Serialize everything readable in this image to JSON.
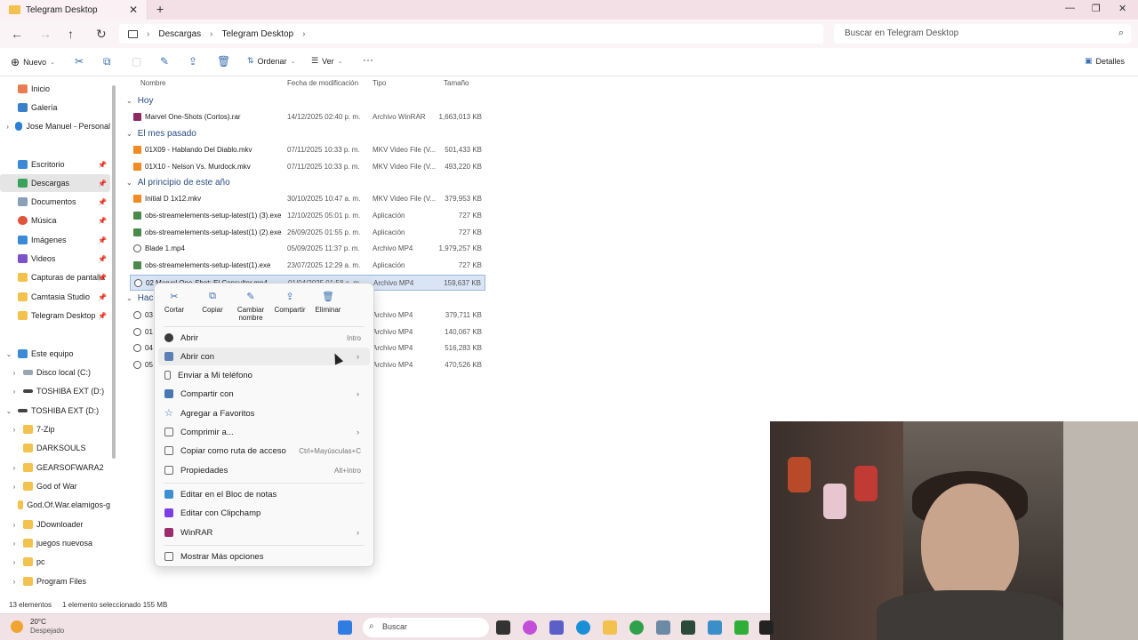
{
  "window": {
    "tab_title": "Telegram Desktop",
    "close_glyph": "✕",
    "new_tab_glyph": "+",
    "minimize_glyph": "—",
    "maximize_glyph": "❐",
    "close_window_glyph": "✕"
  },
  "nav": {
    "back": "←",
    "forward": "→",
    "up": "↑",
    "refresh": "↻",
    "breadcrumbs": [
      "Descargas",
      "Telegram Desktop"
    ],
    "separator": "›",
    "search_placeholder": "Buscar en Telegram Desktop"
  },
  "toolbar": {
    "new_label": "Nuevo",
    "sort_label": "Ordenar",
    "view_label": "Ver",
    "more_label": "···",
    "details_label": "Detalles"
  },
  "sidebar": {
    "items": [
      {
        "label": "Inicio",
        "icon": "home-icon"
      },
      {
        "label": "Galería",
        "icon": "gallery-icon"
      },
      {
        "label": "Jose Manuel - Personal",
        "icon": "cloud-icon"
      },
      {
        "label": "Escritorio",
        "icon": "desktop-icon"
      },
      {
        "label": "Descargas",
        "icon": "download-icon"
      },
      {
        "label": "Documentos",
        "icon": "document-icon"
      },
      {
        "label": "Música",
        "icon": "music-icon"
      },
      {
        "label": "Imágenes",
        "icon": "pictures-icon"
      },
      {
        "label": "Videos",
        "icon": "videos-icon"
      },
      {
        "label": "Capturas de pantalla",
        "icon": "folder-icon"
      },
      {
        "label": "Camtasia Studio",
        "icon": "folder-icon"
      },
      {
        "label": "Telegram Desktop",
        "icon": "folder-icon"
      },
      {
        "label": "Este equipo",
        "icon": "pc-icon"
      },
      {
        "label": "Disco local (C:)",
        "icon": "drive-icon"
      },
      {
        "label": "TOSHIBA EXT (D:)",
        "icon": "drive-icon"
      },
      {
        "label": "TOSHIBA EXT (D:)",
        "icon": "drive-icon"
      },
      {
        "label": "7-Zip",
        "icon": "folder-icon"
      },
      {
        "label": "DARKSOULS",
        "icon": "folder-icon"
      },
      {
        "label": "GEARSOFWARA2",
        "icon": "folder-icon"
      },
      {
        "label": "God of War",
        "icon": "folder-icon"
      },
      {
        "label": "God.Of.War.elamigos-g",
        "icon": "folder-icon"
      },
      {
        "label": "JDownloader",
        "icon": "folder-icon"
      },
      {
        "label": "juegos nuevosa",
        "icon": "folder-icon"
      },
      {
        "label": "pc",
        "icon": "folder-icon"
      },
      {
        "label": "Program Files",
        "icon": "folder-icon"
      }
    ]
  },
  "filelist": {
    "columns": {
      "name": "Nombre",
      "date": "Fecha de modificación",
      "type": "Tipo",
      "size": "Tamaño"
    },
    "groups": [
      {
        "label": "Hoy"
      },
      {
        "label": "El mes pasado"
      },
      {
        "label": "Al principio de este año"
      },
      {
        "label": "Hace"
      }
    ],
    "rows": [
      {
        "name": "Marvel One-Shots (Cortos).rar",
        "date": "14/12/2025 02:40 p. m.",
        "type": "Archivo WinRAR",
        "size": "1,663,013 KB"
      },
      {
        "name": "01X09 - Hablando Del Diablo.mkv",
        "date": "07/11/2025 10:33 p. m.",
        "type": "MKV Video File (V...",
        "size": "501,433 KB"
      },
      {
        "name": "01X10 - Nelson Vs. Murdock.mkv",
        "date": "07/11/2025 10:33 p. m.",
        "type": "MKV Video File (V...",
        "size": "493,220 KB"
      },
      {
        "name": "Initial D 1x12.mkv",
        "date": "30/10/2025 10:47 a. m.",
        "type": "MKV Video File (V...",
        "size": "379,953 KB"
      },
      {
        "name": "obs-streamelements-setup-latest(1) (3).exe",
        "date": "12/10/2025 05:01 p. m.",
        "type": "Aplicación",
        "size": "727 KB"
      },
      {
        "name": "obs-streamelements-setup-latest(1) (2).exe",
        "date": "26/09/2025 01:55 p. m.",
        "type": "Aplicación",
        "size": "727 KB"
      },
      {
        "name": "Blade 1.mp4",
        "date": "05/09/2025 11:37 p. m.",
        "type": "Archivo MP4",
        "size": "1,979,257 KB"
      },
      {
        "name": "obs-streamelements-setup-latest(1).exe",
        "date": "23/07/2025 12:29 a. m.",
        "type": "Aplicación",
        "size": "727 KB"
      },
      {
        "name": "02 Marvel One-Shot: El Consultor.mp4",
        "date": "01/04/2025 01:58 a. m.",
        "type": "Archivo MP4",
        "size": "159,637 KB"
      },
      {
        "name": "03",
        "date": "",
        "type": "Archivo MP4",
        "size": "379,711 KB"
      },
      {
        "name": "01",
        "date": "",
        "type": "Archivo MP4",
        "size": "140,067 KB"
      },
      {
        "name": "04",
        "date": "",
        "type": "Archivo MP4",
        "size": "516,283 KB"
      },
      {
        "name": "05",
        "date": "",
        "type": "Archivo MP4",
        "size": "470,526 KB"
      }
    ]
  },
  "context_menu": {
    "quick_actions": [
      {
        "label": "Cortar",
        "icon": "cut-icon",
        "glyph": "✂"
      },
      {
        "label": "Copiar",
        "icon": "copy-icon",
        "glyph": "⧉"
      },
      {
        "label": "Cambiar nombre",
        "icon": "rename-icon",
        "glyph": "✎"
      },
      {
        "label": "Compartir",
        "icon": "share-icon",
        "glyph": "⇪"
      },
      {
        "label": "Eliminar",
        "icon": "trash-icon",
        "glyph": "🗑"
      }
    ],
    "items": [
      {
        "label": "Abrir",
        "shortcut": "Intro",
        "icon": "play-icon",
        "color": "#3b3b3b"
      },
      {
        "label": "Abrir con",
        "shortcut": "",
        "icon": "open-with-icon",
        "color": "#5a7fb5",
        "submenu": "›"
      },
      {
        "label": "Enviar a Mi teléfono",
        "shortcut": "",
        "icon": "phone-icon",
        "color": "#6a6a6a"
      },
      {
        "label": "Compartir con",
        "shortcut": "",
        "icon": "share-icon",
        "color": "#4a78b5",
        "submenu": "›"
      },
      {
        "label": "Agregar a Favoritos",
        "shortcut": "",
        "icon": "star-icon",
        "color": "#3a6fb0"
      },
      {
        "label": "Comprimir a...",
        "shortcut": "",
        "icon": "zip-icon",
        "color": "#6a6a6a",
        "submenu": "›"
      },
      {
        "label": "Copiar como ruta de acceso",
        "shortcut": "Ctrl+Mayúsculas+C",
        "icon": "path-icon",
        "color": "#6a6a6a"
      },
      {
        "label": "Propiedades",
        "shortcut": "Alt+Intro",
        "icon": "properties-icon",
        "color": "#6a6a6a"
      },
      {
        "label": "Editar en el Bloc de notas",
        "shortcut": "",
        "icon": "notepad-icon",
        "color": "#3d8fd1"
      },
      {
        "label": "Editar con Clipchamp",
        "shortcut": "",
        "icon": "clipchamp-icon",
        "color": "#7b3fe4"
      },
      {
        "label": "WinRAR",
        "shortcut": "",
        "icon": "winrar-icon",
        "color": "#9b2f6e",
        "submenu": "›"
      },
      {
        "label": "Mostrar Más opciones",
        "shortcut": "",
        "icon": "more-options-icon",
        "color": "#6a6a6a"
      }
    ]
  },
  "statusbar": {
    "count": "13 elementos",
    "selection": "1 elemento seleccionado  155 MB"
  },
  "taskbar": {
    "temperature": "20°C",
    "weather": "Despejado",
    "search_label": "Buscar"
  },
  "colors": {
    "accent": "#3a6fb0",
    "selection": "#d9e5f5",
    "folder": "#f2c14e"
  }
}
